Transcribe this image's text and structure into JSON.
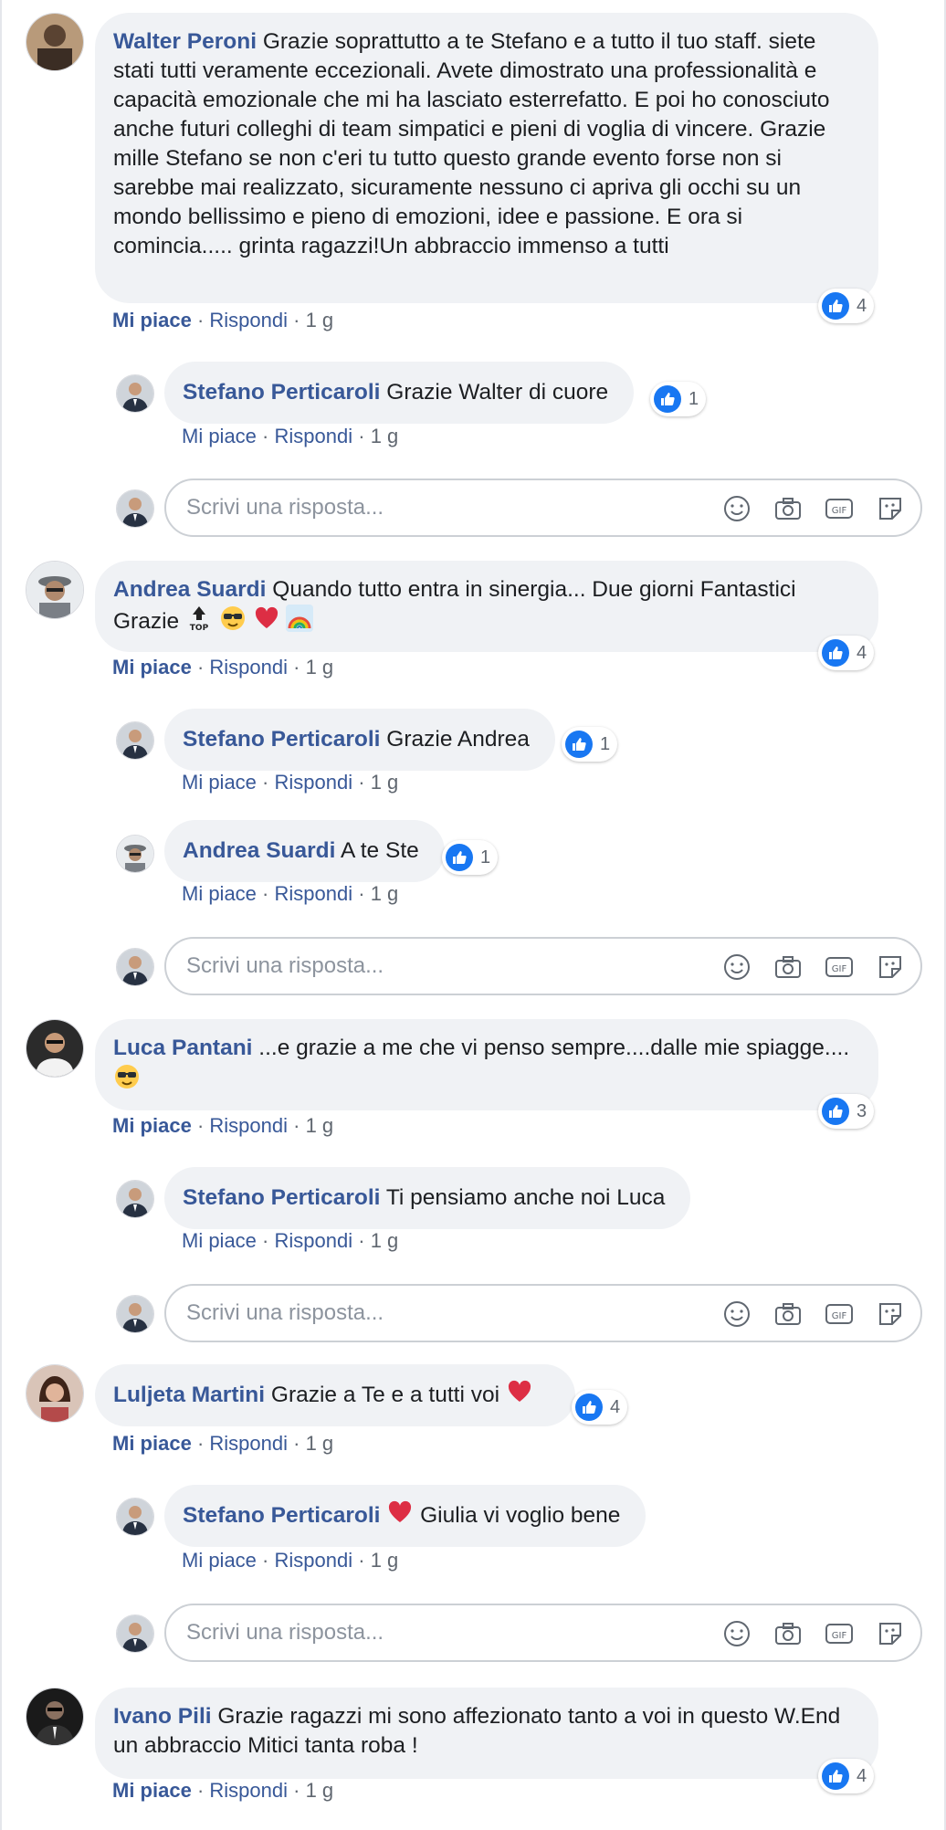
{
  "comments": [
    {
      "author": "Walter Peroni",
      "text": "Grazie soprattutto a te Stefano e a tutto il tuo staff. siete stati tutti veramente eccezionali. Avete dimostrato una professionalità e capacità emozionale che mi ha lasciato esterrefatto. E poi ho conosciuto anche futuri colleghi di team simpatici e pieni di voglia di vincere. Grazie mille Stefano se non c'eri tu tutto questo grande evento forse non si sarebbe mai realizzato, sicuramente nessuno ci apriva gli occhi su un mondo bellissimo e pieno di emozioni, idee e passione. E ora si comincia..... grinta ragazzi!Un abbraccio immenso a tutti",
      "likes": "4",
      "replies": [
        {
          "author": "Stefano Perticaroli",
          "text": "Grazie Walter di cuore",
          "likes": "1"
        }
      ]
    },
    {
      "author": "Andrea Suardi",
      "text_before": "Quando tutto entra in sinergia... Due giorni Fantastici Grazie",
      "emoji_top": "TOP",
      "likes": "4",
      "replies": [
        {
          "author": "Stefano Perticaroli",
          "text": "Grazie Andrea",
          "likes": "1"
        },
        {
          "author": "Andrea Suardi",
          "text": "A te Ste",
          "likes": "1"
        }
      ]
    },
    {
      "author": "Luca Pantani",
      "text": "...e grazie a me che vi penso sempre....dalle mie spiagge....",
      "likes": "3",
      "replies": [
        {
          "author": "Stefano Perticaroli",
          "text": "Ti pensiamo anche noi Luca"
        }
      ]
    },
    {
      "author": "Luljeta Martini",
      "text": "Grazie a Te e a tutti voi",
      "likes": "4",
      "replies": [
        {
          "author": "Stefano Perticaroli",
          "text": "Giulia vi voglio bene"
        }
      ]
    },
    {
      "author": "Ivano Pili",
      "text": "Grazie ragazzi mi sono affezionato tanto a voi in questo W.End un abbraccio Mitici tanta roba !",
      "likes": "4"
    }
  ],
  "actions": {
    "like": "Mi piace",
    "reply": "Rispondi",
    "time": "1 g",
    "separator": "·"
  },
  "reply_box": {
    "placeholder": "Scrivi una risposta..."
  },
  "icons": [
    "thumbs-up-icon",
    "smiley-icon",
    "camera-icon",
    "gif-icon",
    "sticker-icon",
    "heart-emoji",
    "sunglasses-emoji",
    "rainbow-emoji",
    "top-arrow-emoji"
  ],
  "colors": {
    "link": "#385898",
    "bubble": "#f0f2f5",
    "like_blue": "#1877f2",
    "muted": "#606770"
  }
}
